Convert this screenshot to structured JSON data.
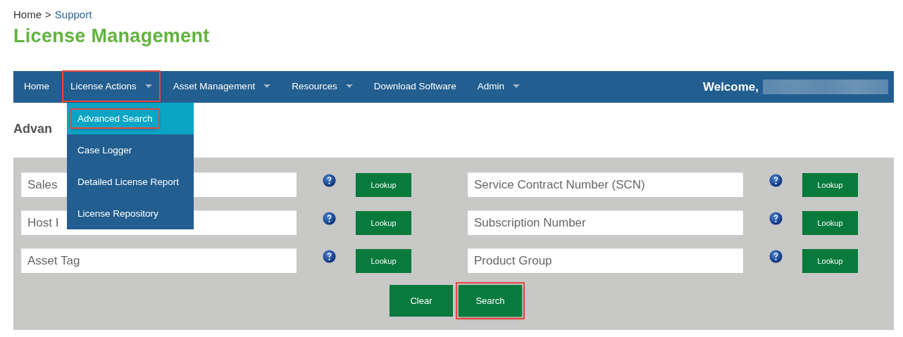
{
  "breadcrumb": [
    {
      "label": "Home",
      "kind": "text"
    },
    {
      "label": ">",
      "kind": "separator"
    },
    {
      "label": "Support",
      "kind": "link"
    }
  ],
  "page_title": "License Management",
  "nav": {
    "items": [
      {
        "label": "Home",
        "has_caret": false,
        "highlighted": false
      },
      {
        "label": "License Actions",
        "has_caret": true,
        "highlighted": true,
        "menu": [
          {
            "label": "Advanced Search",
            "selected": true,
            "highlighted": true
          },
          {
            "label": "Case Logger",
            "selected": false,
            "highlighted": false
          },
          {
            "label": "Detailed License Report",
            "selected": false,
            "highlighted": false
          },
          {
            "label": "License Repository",
            "selected": false,
            "highlighted": false
          }
        ]
      },
      {
        "label": "Asset Management",
        "has_caret": true,
        "highlighted": false
      },
      {
        "label": "Resources",
        "has_caret": true,
        "highlighted": false
      },
      {
        "label": "Download Software",
        "has_caret": false,
        "highlighted": false
      },
      {
        "label": "Admin",
        "has_caret": true,
        "highlighted": false
      }
    ],
    "welcome": "Welcome,"
  },
  "section_heading": "Advan",
  "fields": [
    {
      "placeholder": "Sales",
      "button": "Lookup"
    },
    {
      "placeholder": "Service Contract Number (SCN)",
      "button": "Lookup"
    },
    {
      "placeholder": "Host I",
      "button": "Lookup"
    },
    {
      "placeholder": "Subscription Number",
      "button": "Lookup"
    },
    {
      "placeholder": "Asset Tag",
      "button": "Lookup"
    },
    {
      "placeholder": "Product Group",
      "button": "Lookup"
    }
  ],
  "actions": [
    {
      "label": "Clear",
      "highlighted": false
    },
    {
      "label": "Search",
      "highlighted": true
    }
  ]
}
